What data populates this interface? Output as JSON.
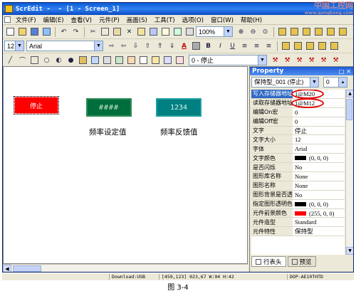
{
  "window": {
    "title": "ScrEdit -  - [1 - Screen_1]"
  },
  "menu": [
    {
      "label": "文件(F)"
    },
    {
      "label": "编辑(E)"
    },
    {
      "label": "查看(V)"
    },
    {
      "label": "元件(P)"
    },
    {
      "label": "画面(S)"
    },
    {
      "label": "工具(T)"
    },
    {
      "label": "选项(O)"
    },
    {
      "label": "窗口(W)"
    },
    {
      "label": "帮助(H)"
    }
  ],
  "toolbar": {
    "zoom": "100%",
    "font_size": "12",
    "font_name": "Arial",
    "state_select": "0 - 停止"
  },
  "canvas": {
    "button_text": "停止",
    "setting_value": "####",
    "feedback_value": "1234",
    "label_setting": "频率设定值",
    "label_feedback": "频率反馈值"
  },
  "property": {
    "title": "Property",
    "object": "保持型_001 (停止)",
    "state": "0",
    "rows": [
      {
        "k": "写入存储器地址",
        "v": "1@M20"
      },
      {
        "k": "读取存储器地址",
        "v": "1@M12"
      },
      {
        "k": "编辑On宏",
        "v": "0"
      },
      {
        "k": "编辑Off宏",
        "v": "0"
      },
      {
        "k": "文字",
        "v": "停止"
      },
      {
        "k": "文字大小",
        "v": "12"
      },
      {
        "k": "字体",
        "v": "Arial"
      },
      {
        "k": "文字颜色",
        "v": "(0, 0, 0)"
      },
      {
        "k": "是否闪烁",
        "v": "No"
      },
      {
        "k": "图形库名称",
        "v": "None"
      },
      {
        "k": "图形名称",
        "v": "None"
      },
      {
        "k": "图形背景是否透",
        "v": "No"
      },
      {
        "k": "指定图形透明色",
        "v": "(0, 0, 0)"
      },
      {
        "k": "元件前景颜色",
        "v": "(255, 0, 0)"
      },
      {
        "k": "元件造型",
        "v": "Standard"
      },
      {
        "k": "元件特性",
        "v": "保持型"
      }
    ],
    "tab_active": "行表头",
    "tab_other": "预览"
  },
  "status": {
    "download": "Download:USB",
    "coords": "[459,123] 023,67 W:94 H:42",
    "device": "DOP-AE10THTD"
  },
  "caption": "图 3-4",
  "watermark": {
    "line1": "中国工控网",
    "line2": "www.gongkong.com"
  },
  "colors": {
    "button_red": "#ff0000",
    "numeric_green": "#006e3c",
    "numeric_teal": "#008080",
    "highlight": "#e00000"
  }
}
